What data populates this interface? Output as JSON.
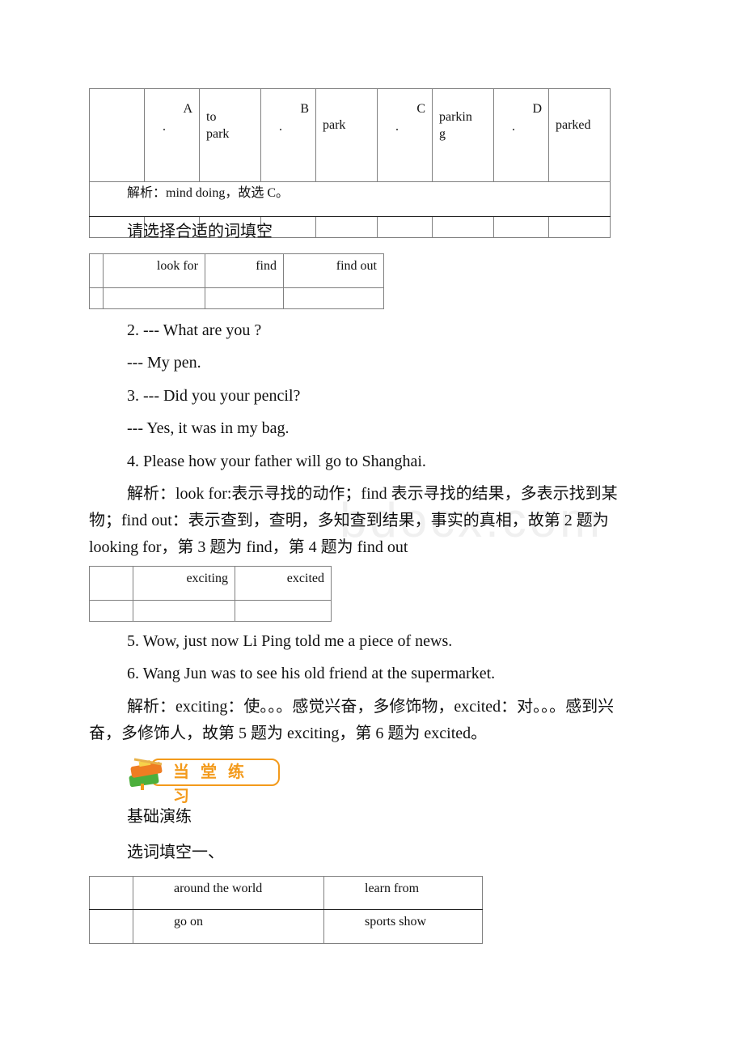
{
  "table1": {
    "options": [
      {
        "letter": "A",
        "dot": ".",
        "text": "to park"
      },
      {
        "letter": "B",
        "dot": ".",
        "text": "park"
      },
      {
        "letter": "C",
        "dot": ".",
        "text": "parking"
      },
      {
        "letter": "D",
        "dot": ".",
        "text": "parked"
      }
    ],
    "option_lines": {
      "a1": "to",
      "a2": "park",
      "c1": "parkin",
      "c2": "g"
    },
    "analysis": "解析：mind doing，故选 C。"
  },
  "section_heading_1": "请选择合适的词填空",
  "table2": {
    "words": [
      "look for",
      "find",
      "find out"
    ]
  },
  "questions_1": [
    "2. --- What are you   ?",
    "--- My pen.",
    "3. --- Did you    your pencil?",
    "--- Yes, it was in my bag.",
    "4. Please    how your father will go to Shanghai."
  ],
  "analysis_2": "解析：look for:表示寻找的动作；find 表示寻找的结果，多表示找到某物；find out：表示查到，查明，多知查到结果，事实的真相，故第 2 题为 looking for，第 3 题为 find，第 4 题为 find out",
  "table3": {
    "words": [
      "exciting",
      "excited"
    ]
  },
  "questions_2": [
    "5. Wow, just now Li Ping told me a piece of    news.",
    "6. Wang Jun was    to see his old friend at the supermarket."
  ],
  "analysis_3": "解析：exciting：使。。。感觉兴奋，多修饰物，excited：对。。。感到兴奋，多修饰人，故第 5 题为 exciting，第 6 题为 excited。",
  "banner": {
    "label": "当堂练习",
    "icon": "books-icon",
    "accent": "#f39a1b"
  },
  "subheading_basic": "基础演练",
  "subheading_fill": "选词填空一、",
  "table4": {
    "rows": [
      [
        "around the world",
        "learn from"
      ],
      [
        "go on",
        "sports show"
      ]
    ]
  },
  "watermark": "bdocx.com"
}
